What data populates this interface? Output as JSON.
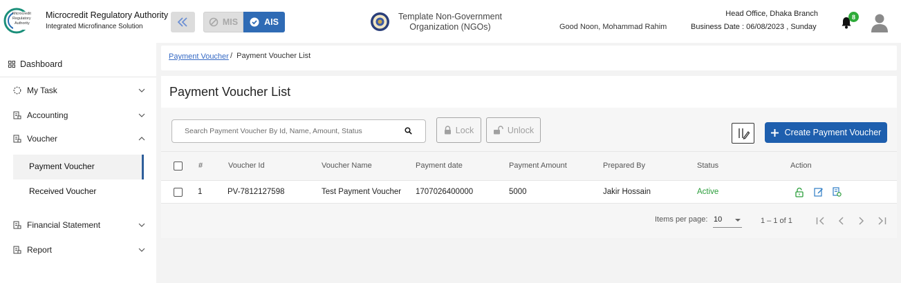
{
  "header": {
    "org_title": "Microcredit Regulatory Authority",
    "org_subtitle": "Integrated Microfinance Solution",
    "logo_text_line1": "Microcredit",
    "logo_text_line2": "Regulatory",
    "logo_text_line3": "Authority",
    "mis_label": "MIS",
    "ais_label": "AIS",
    "ngo_name": "Template Non-Government Organization (NGOs)",
    "greeting": "Good Noon, Mohammad Rahim",
    "branch": "Head Office, Dhaka Branch",
    "business_date": "Business Date : 06/08/2023 , Sunday",
    "notification_count": "8",
    "colors": {
      "accent": "#2f6bb5",
      "badge": "#2eab39"
    }
  },
  "sidebar": {
    "dashboard": "Dashboard",
    "items": [
      {
        "label": "My Task",
        "icon": "circle-dashed-icon"
      },
      {
        "label": "Accounting",
        "icon": "ledger-icon"
      },
      {
        "label": "Voucher",
        "icon": "ledger-icon"
      },
      {
        "label": "Financial Statement",
        "icon": "ledger-icon"
      },
      {
        "label": "Report",
        "icon": "ledger-icon"
      }
    ],
    "voucher_sub": [
      "Payment Voucher",
      "Received Voucher"
    ]
  },
  "breadcrumb": {
    "link": "Payment Voucher",
    "rest": "/  Payment Voucher List"
  },
  "main": {
    "title": "Payment Voucher List",
    "search_placeholder": "Search Payment Voucher By Id, Name, Amount, Status",
    "lock_label": "Lock",
    "unlock_label": "Unlock",
    "create_label": "Create Payment Voucher"
  },
  "table": {
    "headers": [
      "#",
      "Voucher Id",
      "Voucher Name",
      "Payment date",
      "Payment Amount",
      "Prepared By",
      "Status",
      "Action"
    ],
    "rows": [
      {
        "num": "1",
        "id": "PV-7812127598",
        "name": "Test Payment Voucher",
        "date": "1707026400000",
        "amount": "5000",
        "prepared_by": "Jakir Hossain",
        "status": "Active"
      }
    ],
    "status_color": "#2a9d3a"
  },
  "pager": {
    "items_label": "Items per page:",
    "page_size": "10",
    "range": "1 – 1 of 1"
  }
}
